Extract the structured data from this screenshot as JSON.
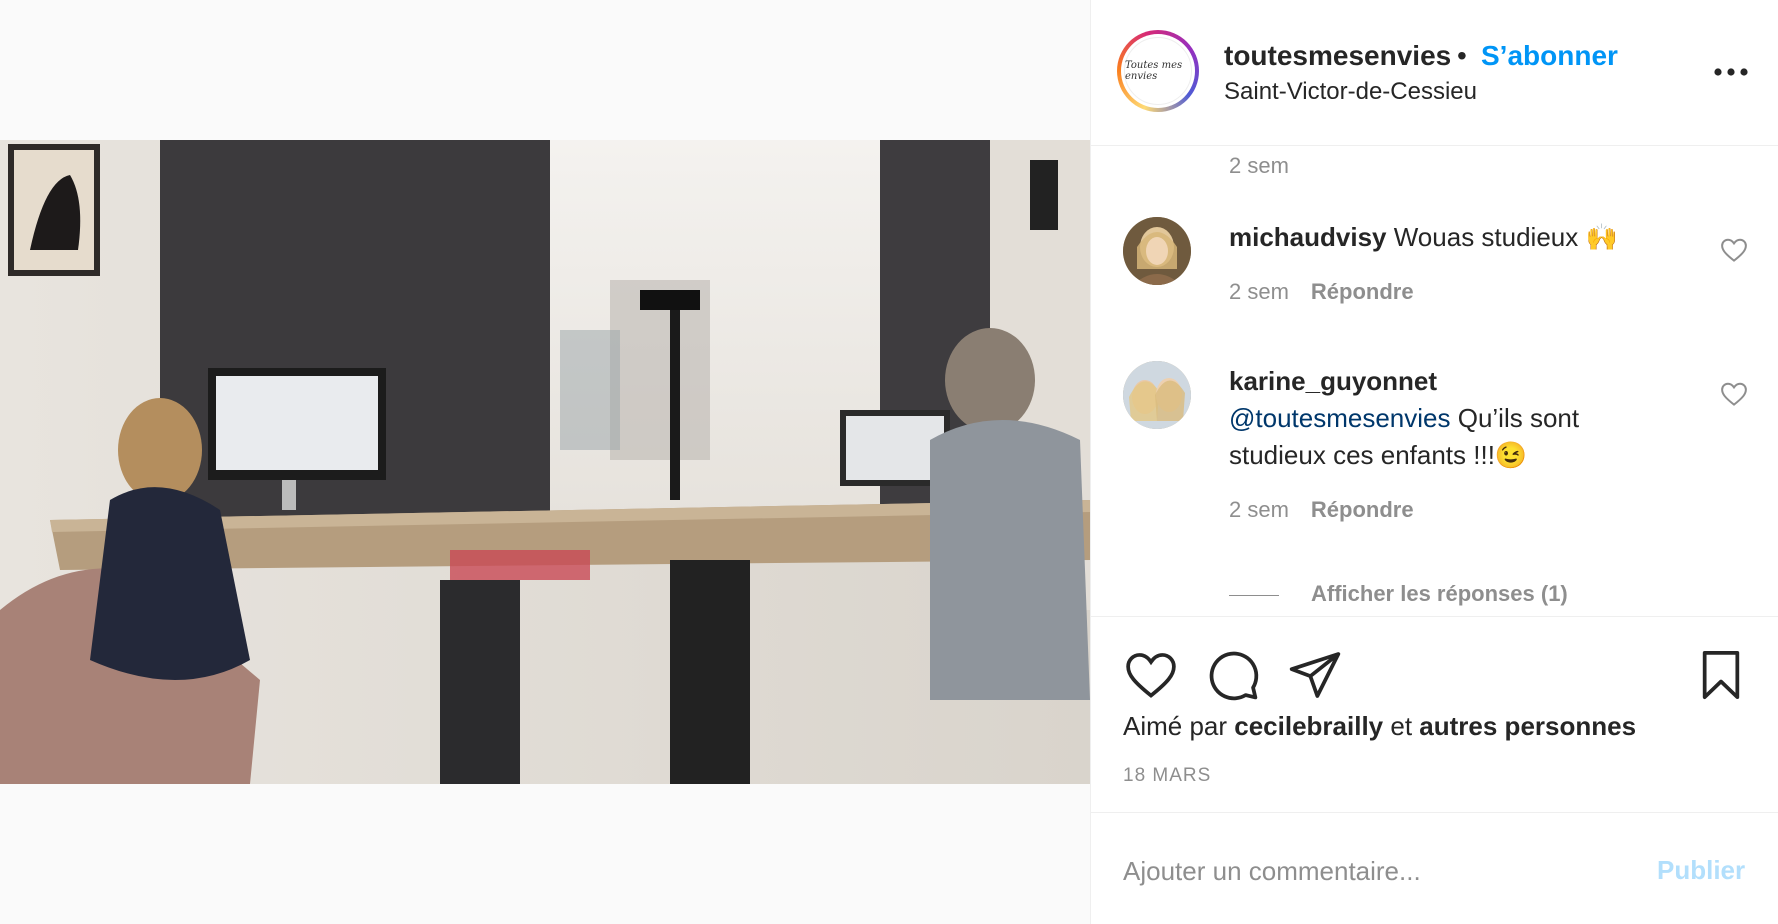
{
  "post": {
    "username": "toutesmesenvies",
    "separator": "•",
    "follow_label": "S’abonner",
    "location": "Saint-Victor-de-Cessieu",
    "more_label": "•••",
    "avatar_text": "Toutes mes envies"
  },
  "comments": {
    "top_time": "2 sem",
    "items": [
      {
        "username": "michaudvisy",
        "text": " Wouas studieux 🙌",
        "time": "2 sem",
        "reply_label": "Répondre"
      },
      {
        "username": "karine_guyonnet",
        "mention": "@toutesmesenvies",
        "text": " Qu’ils sont studieux ces enfants !!!😉",
        "time": "2 sem",
        "reply_label": "Répondre"
      }
    ],
    "view_replies": "Afficher les réponses (1)"
  },
  "likes": {
    "prefix": "Aimé par ",
    "user": "cecilebrailly",
    "middle": " et ",
    "others": "autres personnes"
  },
  "date": "18 MARS",
  "add_comment": {
    "placeholder": "Ajouter un commentaire...",
    "publish_label": "Publier"
  },
  "colors": {
    "accent": "#0095f6",
    "muted": "#8e8e8e",
    "publish_disabled": "#b2dffc"
  }
}
